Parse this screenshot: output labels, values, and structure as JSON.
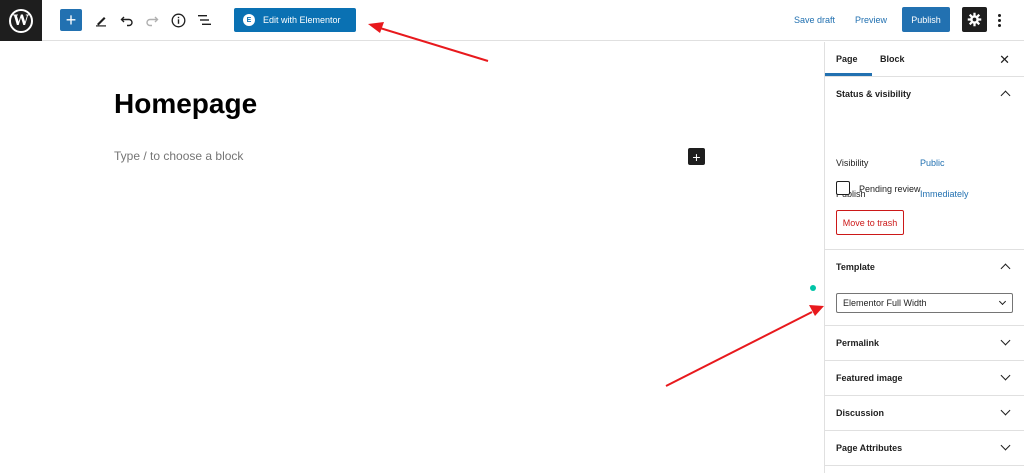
{
  "toolbar": {
    "wp_logo_letter": "W",
    "add_symbol": "+",
    "edit_elementor_icon_letter": "E",
    "edit_elementor_label": "Edit with Elementor",
    "save_draft_label": "Save draft",
    "preview_label": "Preview",
    "publish_label": "Publish",
    "icons": [
      "wordpress-logo-icon",
      "plus-icon",
      "pencil-icon",
      "undo-icon",
      "redo-icon",
      "info-icon",
      "list-view-icon",
      "gear-icon",
      "more-vertical-icon"
    ]
  },
  "editor": {
    "title": "Homepage",
    "placeholder": "Type / to choose a block",
    "inserter_symbol": "+"
  },
  "sidebar": {
    "tabs": {
      "page": "Page",
      "block": "Block"
    },
    "close_symbol": "✕",
    "status": {
      "title": "Status & visibility",
      "visibility_label": "Visibility",
      "visibility_value": "Public",
      "publish_label": "Publish",
      "publish_value": "Immediately",
      "pending_label": "Pending review",
      "trash_label": "Move to trash"
    },
    "template": {
      "title": "Template",
      "selected": "Elementor Full Width"
    },
    "permalink_title": "Permalink",
    "featured_image_title": "Featured image",
    "discussion_title": "Discussion",
    "page_attributes_title": "Page Attributes"
  },
  "colors": {
    "accent": "#2271b1",
    "elementor": "#0a71b3",
    "danger": "#cc1818",
    "dark": "#1e1e1e",
    "annotation_arrow": "#e8191d"
  }
}
